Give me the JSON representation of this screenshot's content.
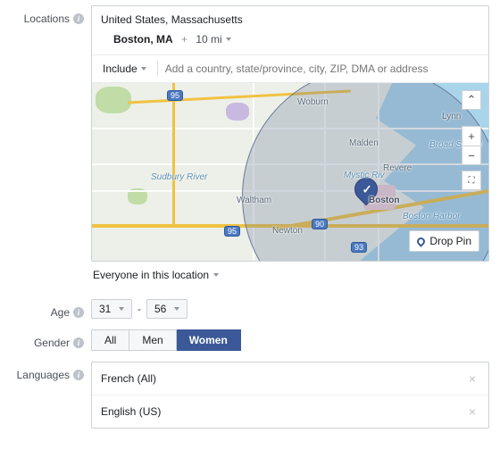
{
  "labels": {
    "locations": "Locations",
    "age": "Age",
    "gender": "Gender",
    "languages": "Languages"
  },
  "locations": {
    "region": "United States, Massachusetts",
    "city": "Boston, MA",
    "plus": "+",
    "radius": "10 mi",
    "include_label": "Include",
    "address_placeholder": "Add a country, state/province, city, ZIP, DMA or address",
    "scope": "Everyone in this location",
    "drop_pin_label": "Drop Pin"
  },
  "map_labels": {
    "woburn": "Woburn",
    "lynn": "Lynn",
    "malden": "Malden",
    "revere": "Revere",
    "waltham": "Waltham",
    "newton": "Newton",
    "boston": "Boston",
    "sudbury": "Sudbury River",
    "mystic": "Mystic Riv",
    "broad_sound": "Broad Sound",
    "boston_harbor": "Boston Harbor",
    "i90": "90",
    "i93": "93",
    "i95a": "95",
    "i95b": "95"
  },
  "age": {
    "min": "31",
    "max": "56",
    "sep": "-"
  },
  "gender": {
    "all": "All",
    "men": "Men",
    "women": "Women"
  },
  "languages": {
    "items": [
      "French (All)",
      "English (US)"
    ]
  }
}
